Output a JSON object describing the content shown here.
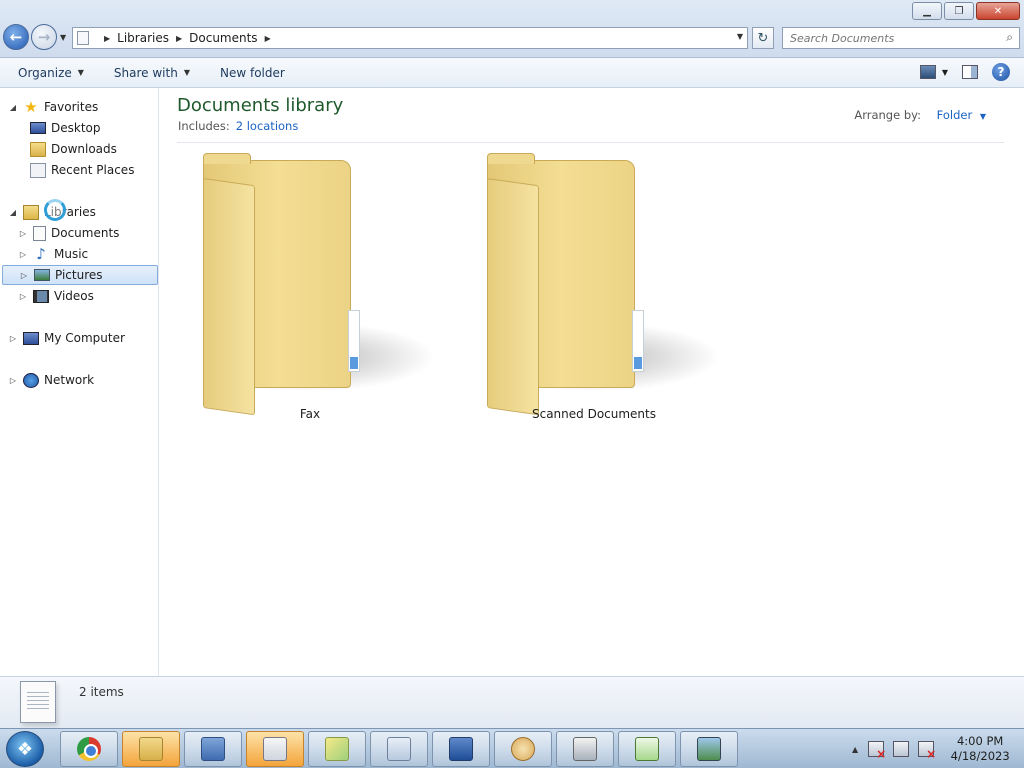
{
  "window": {
    "minimize": "▁",
    "maximize": "❐",
    "close": "✕"
  },
  "address_bar": {
    "back_glyph": "←",
    "forward_glyph": "→",
    "crumbs": [
      "Libraries",
      "Documents"
    ],
    "refresh_glyph": "↻"
  },
  "search": {
    "placeholder": "Search Documents",
    "icon": "search-icon"
  },
  "toolbar": {
    "organize": "Organize",
    "share_with": "Share with",
    "new_folder": "New folder",
    "help": "?"
  },
  "nav_pane": {
    "favorites": {
      "label": "Favorites",
      "items": [
        "Desktop",
        "Downloads",
        "Recent Places"
      ]
    },
    "libraries": {
      "label": "Libraries",
      "items": [
        "Documents",
        "Music",
        "Pictures",
        "Videos"
      ],
      "selected": "Pictures"
    },
    "my_computer": "My Computer",
    "network": "Network"
  },
  "content": {
    "title": "Documents library",
    "includes_label": "Includes:",
    "includes_link": "2 locations",
    "arrange_label": "Arrange by:",
    "arrange_value": "Folder",
    "folders": [
      {
        "name": "Fax"
      },
      {
        "name": "Scanned Documents"
      }
    ]
  },
  "details": {
    "count": "2 items"
  },
  "taskbar": {
    "start_glyph": "❖",
    "pinned": [
      {
        "name": "chrome",
        "icon": "chrome-icon"
      },
      {
        "name": "windows-explorer",
        "icon": "folder-icon",
        "active": true
      },
      {
        "name": "control-panel",
        "icon": "control-panel-icon"
      },
      {
        "name": "calculator",
        "icon": "calculator-icon",
        "active": true
      },
      {
        "name": "sticky-notes",
        "icon": "sticky-notes-icon"
      },
      {
        "name": "file-viewer",
        "icon": "file-icon"
      },
      {
        "name": "remote-desktop",
        "icon": "remote-desktop-icon"
      },
      {
        "name": "paint",
        "icon": "paint-icon"
      },
      {
        "name": "fax-scan",
        "icon": "fax-icon"
      },
      {
        "name": "chart-app",
        "icon": "chart-icon"
      },
      {
        "name": "photo-viewer",
        "icon": "photo-icon"
      }
    ],
    "clock_time": "4:00 PM",
    "clock_date": "4/18/2023"
  }
}
